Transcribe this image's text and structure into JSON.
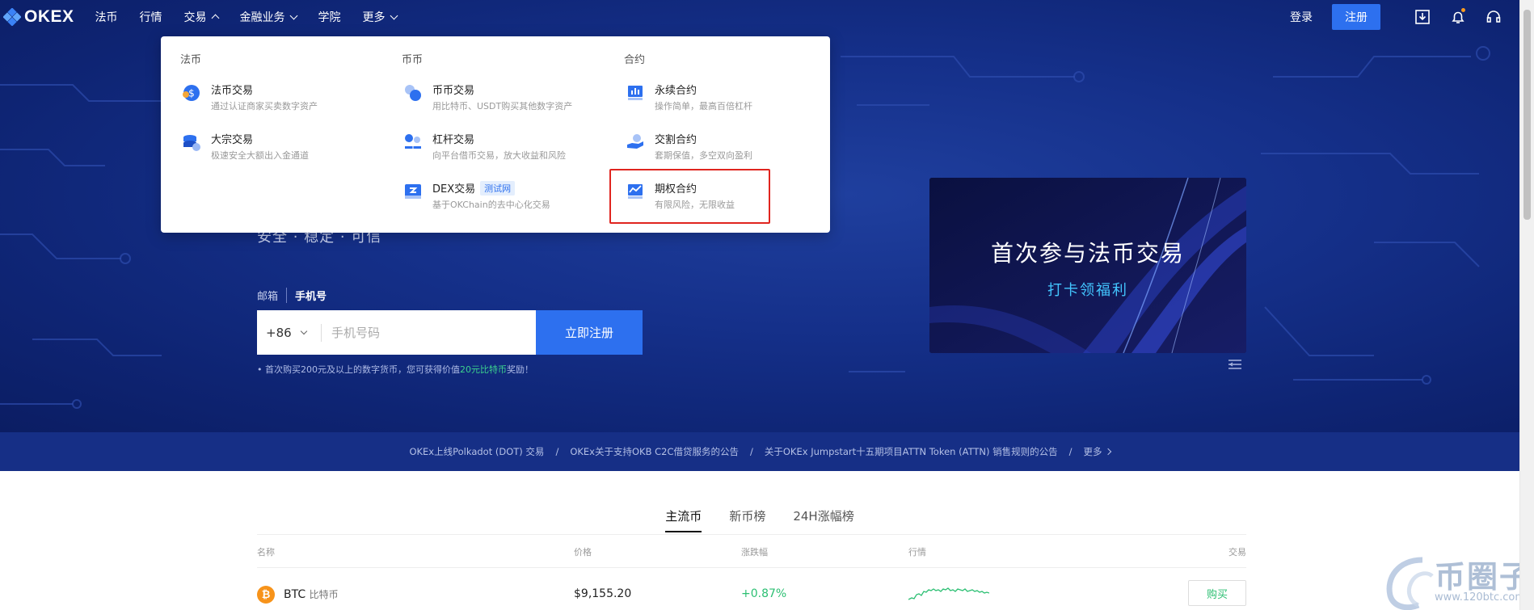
{
  "nav": {
    "logo": "OKEX",
    "items": [
      {
        "label": "法币",
        "chevron": "none"
      },
      {
        "label": "行情",
        "chevron": "none"
      },
      {
        "label": "交易",
        "chevron": "up"
      },
      {
        "label": "金融业务",
        "chevron": "down"
      },
      {
        "label": "学院",
        "chevron": "none"
      },
      {
        "label": "更多",
        "chevron": "down"
      }
    ],
    "login": "登录",
    "register": "注册",
    "icons": [
      "download-icon",
      "bell-icon",
      "headset-icon"
    ]
  },
  "dropdown": {
    "columns": [
      {
        "title": "法币",
        "items": [
          {
            "name": "法币交易",
            "desc": "通过认证商家买卖数字资产",
            "icon": "dollar-coin-icon"
          },
          {
            "name": "大宗交易",
            "desc": "极速安全大额出入金通道",
            "icon": "coin-stack-icon"
          }
        ]
      },
      {
        "title": "币币",
        "items": [
          {
            "name": "币币交易",
            "desc": "用比特币、USDT购买其他数字资产",
            "icon": "coins-exchange-icon"
          },
          {
            "name": "杠杆交易",
            "desc": "向平台借币交易，放大收益和风险",
            "icon": "leverage-icon"
          },
          {
            "name": "DEX交易",
            "desc": "基于OKChain的去中心化交易",
            "icon": "dex-icon",
            "tag": "测试网"
          }
        ]
      },
      {
        "title": "合约",
        "items": [
          {
            "name": "永续合约",
            "desc": "操作简单，最高百倍杠杆",
            "icon": "perpetual-chart-icon"
          },
          {
            "name": "交割合约",
            "desc": "套期保值，多空双向盈利",
            "icon": "delivery-hand-icon"
          },
          {
            "name": "期权合约",
            "desc": "有限风险，无限收益",
            "icon": "options-chart-icon",
            "highlighted": true
          }
        ]
      }
    ]
  },
  "hero": {
    "slogan": "安全 · 稳定 · 可信",
    "tab_email": "邮箱",
    "tab_phone": "手机号",
    "country_code": "+86",
    "phone_placeholder": "手机号码",
    "submit": "立即注册",
    "promo_prefix": "• 首次购买200元及以上的数字货币，您可获得价值",
    "promo_highlight": "20元比特币",
    "promo_suffix": "奖励！"
  },
  "banner": {
    "title": "首次参与法币交易",
    "subtitle": "打卡领福利"
  },
  "announcements": {
    "items": [
      "OKEx上线Polkadot (DOT) 交易",
      "OKEx关于支持OKB C2C借贷服务的公告",
      "关于OKEx Jumpstart十五期项目ATTN Token (ATTN) 销售规则的公告"
    ],
    "separator": "/",
    "more": "更多"
  },
  "market": {
    "tabs": [
      "主流币",
      "新币榜",
      "24H涨幅榜"
    ],
    "active_tab": 0,
    "headers": {
      "name": "名称",
      "price": "价格",
      "change": "涨跌幅",
      "trend": "行情",
      "trade": "交易"
    },
    "rows": [
      {
        "symbol": "BTC",
        "name_cn": "比特币",
        "price": "$9,155.20",
        "change": "+0.87%",
        "action": "购买"
      }
    ]
  },
  "watermark": {
    "text": "币圈子",
    "url": "www.120btc.com"
  },
  "colors": {
    "brand_blue": "#2d70ef",
    "hero_bg": "#15308a",
    "positive": "#2bbf72",
    "highlight_border": "#e0251f"
  }
}
